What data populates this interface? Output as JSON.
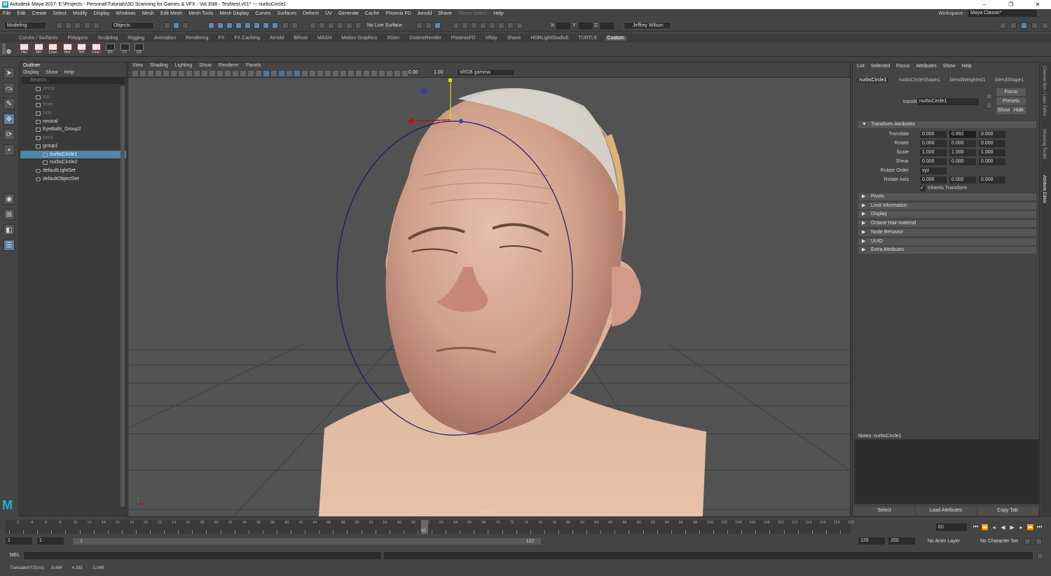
{
  "window": {
    "title": "Autodesk Maya 2017: E:\\Projects - Personal\\Tutorials\\3D Scanning for Games & VFX - Vol.3\\98 - Test\\test.v01*  ---  nurbsCircle1",
    "controls": [
      "–",
      "❐",
      "✕"
    ]
  },
  "menubar": {
    "items": [
      "File",
      "Edit",
      "Create",
      "Select",
      "Modify",
      "Display",
      "Windows",
      "Mesh",
      "Edit Mesh",
      "Mesh Tools",
      "Mesh Display",
      "Curves",
      "Surfaces",
      "Deform",
      "UV",
      "Generate",
      "Cache",
      "Phoenix FD",
      "Arnold",
      "Shave",
      "Shave Select",
      "Help"
    ],
    "workspace_label": "Workspace :",
    "workspace_value": "Maya Classic*"
  },
  "statusline": {
    "mode": "Modeling",
    "objects": "Objects",
    "live_surface": "No Live Surface",
    "x_label": "X:",
    "y_label": "Y:",
    "z_label": "Z:",
    "user": "Jeffrey Wilson"
  },
  "shelf": {
    "tabs": [
      "Curves / Surfaces",
      "Polygons",
      "Sculpting",
      "Rigging",
      "Animation",
      "Rendering",
      "FX",
      "FX Caching",
      "Arnold",
      "Bifrost",
      "MASH",
      "Motion Graphics",
      "XGen",
      "OctaneRender",
      "PhoenixFD",
      "VRay",
      "Shave",
      "HDRLightStudio5",
      "TURTLE",
      "Custom"
    ],
    "active_tab": "Custom",
    "icons": [
      "Hist",
      "NH",
      "Chan",
      "Hist",
      "NH",
      "Chan",
      "RT",
      "FT",
      "CP"
    ]
  },
  "outliner": {
    "title": "Outliner",
    "menu": [
      "Display",
      "Show",
      "Help"
    ],
    "search_placeholder": "Search...",
    "items": [
      {
        "label": "persp",
        "dim": true
      },
      {
        "label": "top",
        "dim": true
      },
      {
        "label": "front",
        "dim": true
      },
      {
        "label": "side",
        "dim": true
      },
      {
        "label": "neutral",
        "dim": false
      },
      {
        "label": "EyeBalls_Group2",
        "dim": false
      },
      {
        "label": "back",
        "dim": true
      },
      {
        "label": "group1",
        "dim": false
      },
      {
        "label": "nurbsCircle1",
        "dim": false,
        "selected": true
      },
      {
        "label": "nurbsCircle2",
        "dim": false
      },
      {
        "label": "defaultLightSet",
        "dim": false
      },
      {
        "label": "defaultObjectSet",
        "dim": false
      }
    ]
  },
  "viewport": {
    "menu": [
      "View",
      "Shading",
      "Lighting",
      "Show",
      "Renderer",
      "Panels"
    ],
    "exposure": "0.00",
    "gamma": "1.00",
    "color_space": "sRGB gamma",
    "camera_label": "persp"
  },
  "attribute_editor": {
    "menu": [
      "List",
      "Selected",
      "Focus",
      "Attributes",
      "Show",
      "Help"
    ],
    "tabs": [
      "nurbsCircle1",
      "nurbsCircleShape1",
      "blendWeighted1",
      "blendShape1"
    ],
    "transform_label": "transform:",
    "transform_value": "nurbsCircle1",
    "buttons": {
      "focus": "Focus",
      "presets": "Presets",
      "show": "Show",
      "hide": "Hide"
    },
    "transform_section": "Transform Attributes",
    "rows": [
      {
        "label": "Translate",
        "values": [
          "0.000",
          "0.992",
          "0.000"
        ]
      },
      {
        "label": "Rotate",
        "values": [
          "0.000",
          "0.000",
          "0.000"
        ]
      },
      {
        "label": "Scale",
        "values": [
          "1.000",
          "1.000",
          "1.000"
        ]
      },
      {
        "label": "Shear",
        "values": [
          "0.000",
          "0.000",
          "0.000"
        ]
      }
    ],
    "rotate_order_label": "Rotate Order",
    "rotate_order_value": "xyz",
    "rotate_axis_label": "Rotate Axis",
    "rotate_axis_values": [
      "0.000",
      "0.000",
      "0.000"
    ],
    "inherits_transform": "Inherits Transform",
    "sections": [
      "Pivots",
      "Limit Information",
      "Display",
      "Octane Hair material",
      "Node Behavior",
      "UUID",
      "Extra Attributes"
    ],
    "notes_label": "Notes:  nurbsCircle1",
    "bottom_buttons": [
      "Select",
      "Load Attributes",
      "Copy Tab"
    ]
  },
  "side_tabs": [
    "Channel Box / Layer Editor",
    "Modeling Toolkit",
    "Attribute Editor"
  ],
  "timeline": {
    "start": 1,
    "end": 120,
    "current_frame": "60",
    "tick_step": 2,
    "label_step": 2
  },
  "range": {
    "start_a": "1",
    "start_b": "1",
    "slider_start": "1",
    "slider_end": "120",
    "end_a": "120",
    "end_b": "200",
    "anim_layer": "No Anim Layer",
    "char_set": "No Character Set"
  },
  "cmd": {
    "label": "MEL"
  },
  "help": {
    "label": "TranslateXYZ(cm):",
    "values": [
      "-0.484",
      "4.193",
      "-1.048"
    ]
  },
  "colors": {
    "accent": "#5285a6",
    "bg": "#444444",
    "viewport": "#505050",
    "circle": "#1a1a6a"
  },
  "icons": [
    "select-tool-icon",
    "lasso-icon",
    "paint-icon",
    "move-icon",
    "rotate-icon",
    "scale-icon",
    "maya-logo-icon"
  ]
}
